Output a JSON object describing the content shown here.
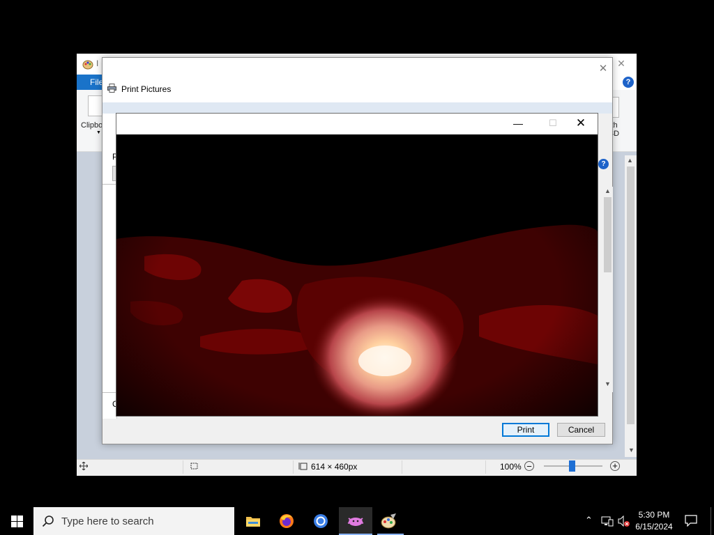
{
  "paint": {
    "title_initial": "I",
    "file_tab": "File",
    "clipboard_label": "Clipbo",
    "with3d_label_line1": "ith",
    "with3d_label_line2": "3D",
    "status": {
      "image_size": "614 × 460px",
      "zoom": "100%"
    }
  },
  "print_dialog": {
    "title": "Print Pictures",
    "left_label_p": "P",
    "left_label_c": "C",
    "print_button": "Print",
    "cancel_button": "Cancel"
  },
  "taskbar": {
    "search_placeholder": "Type here to search",
    "time": "5:30 PM",
    "date": "6/15/2024"
  },
  "icons": {
    "start": "windows-logo",
    "search": "magnifier",
    "apps": [
      "file-explorer",
      "firefox",
      "chrome",
      "paint-app",
      "paint-classic"
    ],
    "tray": [
      "chevron-up",
      "network",
      "volume-muted",
      "notifications"
    ]
  },
  "colors": {
    "accent": "#0078d7",
    "file_tab": "#1a73c9",
    "taskbar": "#000000"
  }
}
